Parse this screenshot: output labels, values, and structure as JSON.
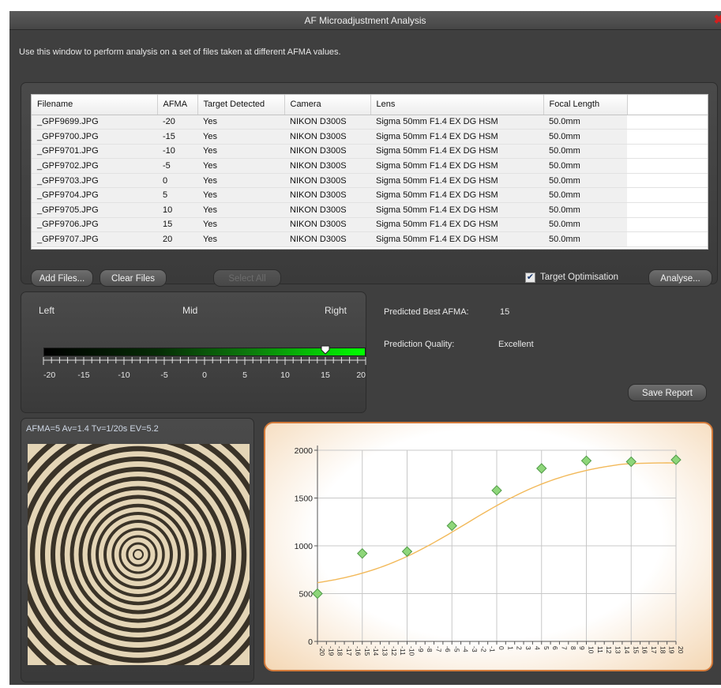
{
  "window": {
    "title": "AF Microadjustment Analysis",
    "close_glyph": "✖"
  },
  "intro_text": "Use this window to perform analysis on a set of files taken at different AFMA values.",
  "table": {
    "columns": [
      "Filename",
      "AFMA",
      "Target Detected",
      "Camera",
      "Lens",
      "Focal Length"
    ],
    "rows": [
      [
        "_GPF9699.JPG",
        "-20",
        "Yes",
        "NIKON D300S",
        "Sigma 50mm F1.4 EX DG HSM",
        "50.0mm"
      ],
      [
        "_GPF9700.JPG",
        "-15",
        "Yes",
        "NIKON D300S",
        "Sigma 50mm F1.4 EX DG HSM",
        "50.0mm"
      ],
      [
        "_GPF9701.JPG",
        "-10",
        "Yes",
        "NIKON D300S",
        "Sigma 50mm F1.4 EX DG HSM",
        "50.0mm"
      ],
      [
        "_GPF9702.JPG",
        "-5",
        "Yes",
        "NIKON D300S",
        "Sigma 50mm F1.4 EX DG HSM",
        "50.0mm"
      ],
      [
        "_GPF9703.JPG",
        "0",
        "Yes",
        "NIKON D300S",
        "Sigma 50mm F1.4 EX DG HSM",
        "50.0mm"
      ],
      [
        "_GPF9704.JPG",
        "5",
        "Yes",
        "NIKON D300S",
        "Sigma 50mm F1.4 EX DG HSM",
        "50.0mm"
      ],
      [
        "_GPF9705.JPG",
        "10",
        "Yes",
        "NIKON D300S",
        "Sigma 50mm F1.4 EX DG HSM",
        "50.0mm"
      ],
      [
        "_GPF9706.JPG",
        "15",
        "Yes",
        "NIKON D300S",
        "Sigma 50mm F1.4 EX DG HSM",
        "50.0mm"
      ],
      [
        "_GPF9707.JPG",
        "20",
        "Yes",
        "NIKON D300S",
        "Sigma 50mm F1.4 EX DG HSM",
        "50.0mm"
      ]
    ]
  },
  "buttons": {
    "add_files": "Add Files...",
    "clear_files": "Clear Files",
    "select_all": "Select All",
    "analyse": "Analyse...",
    "save_report": "Save Report"
  },
  "target_optimisation": {
    "label": "Target Optimisation",
    "checked": true,
    "check_glyph": "✔"
  },
  "scale": {
    "left_label": "Left",
    "mid_label": "Mid",
    "right_label": "Right",
    "min": -20,
    "max": 20,
    "tick_labels": [
      "-20",
      "-15",
      "-10",
      "-5",
      "0",
      "5",
      "10",
      "15",
      "20"
    ],
    "marker_value": 15
  },
  "results": {
    "best_label": "Predicted Best AFMA:",
    "best_value": "15",
    "quality_label": "Prediction Quality:",
    "quality_value": "Excellent"
  },
  "image_caption": "AFMA=5  Av=1.4  Tv=1/20s  EV=5.2",
  "chart_data": {
    "type": "scatter",
    "x": [
      -20,
      -15,
      -10,
      -5,
      0,
      5,
      10,
      15,
      20
    ],
    "values": [
      500,
      920,
      940,
      1210,
      1580,
      1810,
      1890,
      1880,
      1900
    ],
    "trend_line": true,
    "xlim": [
      -20,
      20
    ],
    "ylim": [
      0,
      2000
    ],
    "ytick_labels": [
      "0",
      "500",
      "1000",
      "1500",
      "2000"
    ],
    "xtick_labels": [
      "-20",
      "-19",
      "-18",
      "-17",
      "-16",
      "-15",
      "-14",
      "-13",
      "-12",
      "-11",
      "-10",
      "-9",
      "-8",
      "-7",
      "-6",
      "-5",
      "-4",
      "-3",
      "-2",
      "-1",
      "0",
      "1",
      "2",
      "3",
      "4",
      "5",
      "6",
      "7",
      "8",
      "9",
      "10",
      "11",
      "12",
      "13",
      "14",
      "15",
      "16",
      "17",
      "18",
      "19",
      "20"
    ],
    "grid": true,
    "marker_color": "#8ed67a",
    "line_color": "#f2b95a"
  }
}
